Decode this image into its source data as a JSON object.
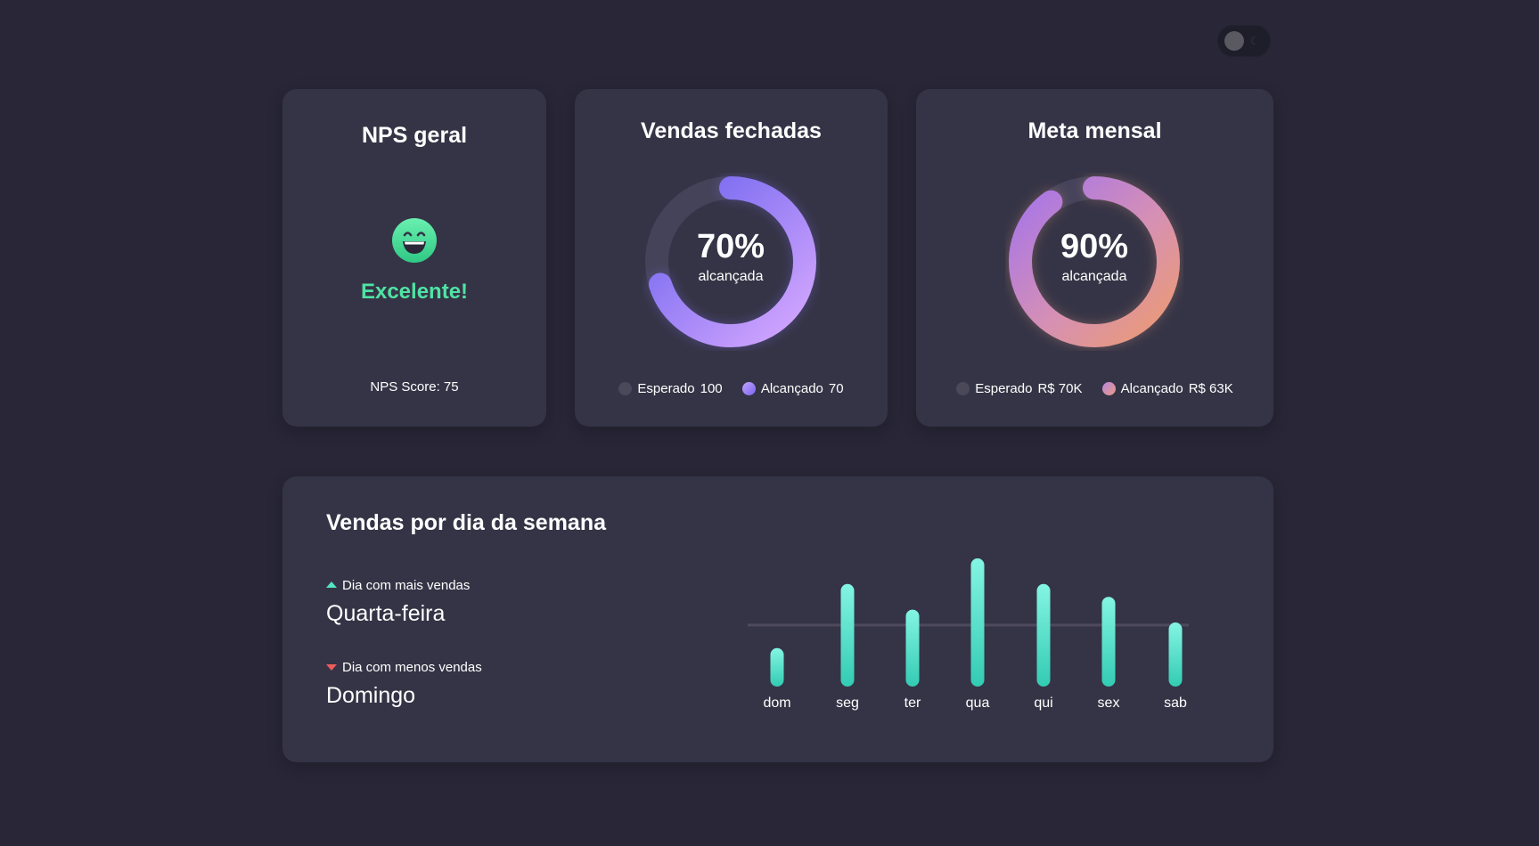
{
  "theme_toggle": {
    "icon": "moon-icon"
  },
  "nps": {
    "title": "NPS geral",
    "icon": "smiley-icon",
    "status": "Excelente!",
    "score_text": "NPS Score: 75",
    "colors": {
      "status": "#4fe3a4"
    }
  },
  "vendas": {
    "title": "Vendas fechadas",
    "percent_text": "70%",
    "percent_value": 70,
    "subtitle": "alcançada",
    "legend": [
      {
        "label": "Esperado",
        "value": "100",
        "color": "#4a4859"
      },
      {
        "label": "Alcançado",
        "value": "70",
        "color": "#8f7cf5"
      }
    ],
    "gradient": [
      "#c9a0ff",
      "#6f64ee"
    ],
    "track_color": "#45435a"
  },
  "meta": {
    "title": "Meta mensal",
    "percent_text": "90%",
    "percent_value": 90,
    "subtitle": "alcançada",
    "legend": [
      {
        "label": "Esperado",
        "value": "R$ 70K",
        "color": "#4a4859"
      },
      {
        "label": "Alcançado",
        "value": "R$ 63K",
        "color": "#c88fc2"
      }
    ],
    "gradient": [
      "#a77ae8",
      "#e8947a"
    ],
    "track_color": "#45435a"
  },
  "semana": {
    "title": "Vendas por dia da semana",
    "best_label": "Dia com mais vendas",
    "best_value": "Quarta-feira",
    "worst_label": "Dia com menos vendas",
    "worst_value": "Domingo",
    "colors": {
      "up": "#52e6c2",
      "down": "#ee5c5c",
      "bar_top": "#7ff3e0",
      "bar_bottom": "#36cdb5"
    }
  },
  "chart_data": {
    "type": "bar",
    "categories": [
      "dom",
      "seg",
      "ter",
      "qua",
      "qui",
      "sex",
      "sab"
    ],
    "values": [
      30,
      80,
      60,
      100,
      80,
      70,
      50
    ],
    "reference_line": 48,
    "ylim": [
      0,
      100
    ],
    "grid": false,
    "title": "",
    "xlabel": "",
    "ylabel": ""
  }
}
